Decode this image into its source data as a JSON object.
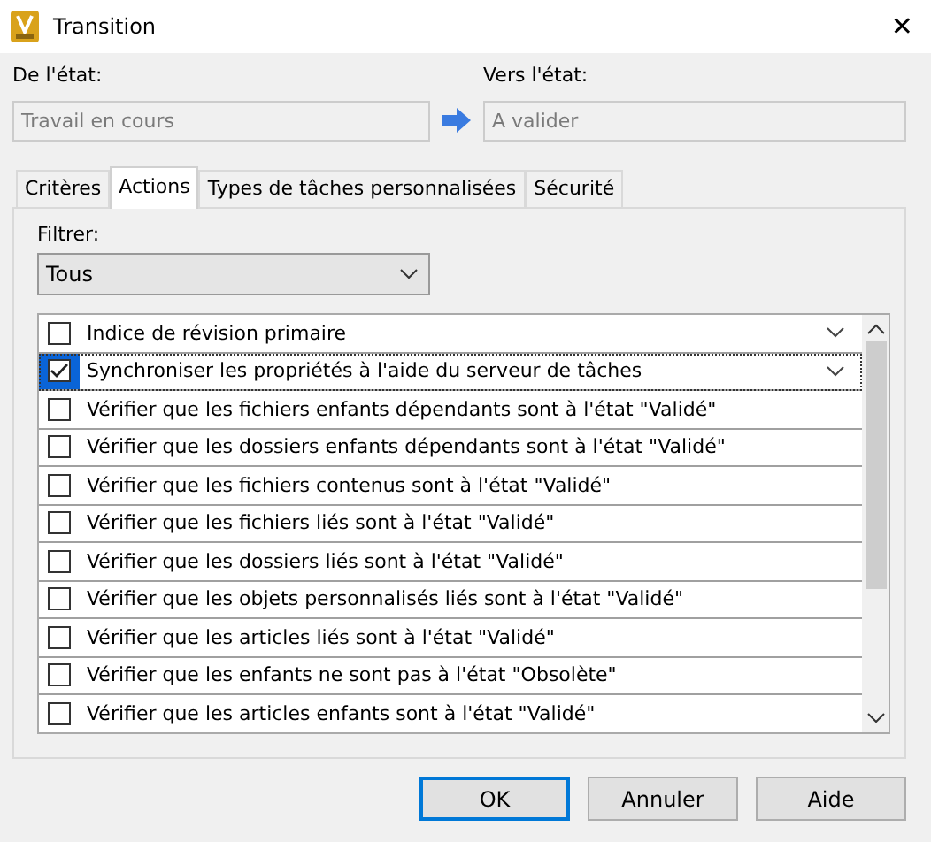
{
  "window": {
    "title": "Transition",
    "close": "✕"
  },
  "from_state": {
    "label": "De l'état:",
    "value": "Travail en cours"
  },
  "to_state": {
    "label": "Vers l'état:",
    "value": "A valider"
  },
  "tabs": [
    {
      "label": "Critères",
      "selected": false
    },
    {
      "label": "Actions",
      "selected": true
    },
    {
      "label": "Types de tâches personnalisées",
      "selected": false
    },
    {
      "label": "Sécurité",
      "selected": false
    }
  ],
  "filter": {
    "label": "Filtrer:",
    "value": "Tous"
  },
  "actions": [
    {
      "label": "Indice de révision primaire",
      "checked": false,
      "selected": false,
      "kind": "dropdown"
    },
    {
      "label": "Synchroniser les propriétés à l'aide du serveur de tâches",
      "checked": true,
      "selected": true,
      "kind": "dropdown"
    },
    {
      "label": "Vérifier que les fichiers enfants dépendants sont à l'état \"Validé\"",
      "checked": false,
      "selected": false,
      "kind": "plain"
    },
    {
      "label": "Vérifier que les dossiers enfants dépendants sont à l'état \"Validé\"",
      "checked": false,
      "selected": false,
      "kind": "plain"
    },
    {
      "label": "Vérifier que les fichiers contenus sont à l'état \"Validé\"",
      "checked": false,
      "selected": false,
      "kind": "plain"
    },
    {
      "label": "Vérifier que les fichiers liés sont à l'état \"Validé\"",
      "checked": false,
      "selected": false,
      "kind": "plain"
    },
    {
      "label": "Vérifier que les dossiers liés sont à l'état \"Validé\"",
      "checked": false,
      "selected": false,
      "kind": "plain"
    },
    {
      "label": "Vérifier que les objets personnalisés liés sont à l'état \"Validé\"",
      "checked": false,
      "selected": false,
      "kind": "plain"
    },
    {
      "label": "Vérifier que les articles liés sont à l'état \"Validé\"",
      "checked": false,
      "selected": false,
      "kind": "plain"
    },
    {
      "label": "Vérifier que les enfants ne sont pas à l'état \"Obsolète\"",
      "checked": false,
      "selected": false,
      "kind": "plain"
    },
    {
      "label": "Vérifier que les articles enfants sont à l'état \"Validé\"",
      "checked": false,
      "selected": false,
      "kind": "plain"
    }
  ],
  "buttons": [
    {
      "label": "OK",
      "default": true
    },
    {
      "label": "Annuler",
      "default": false
    },
    {
      "label": "Aide",
      "default": false
    }
  ]
}
